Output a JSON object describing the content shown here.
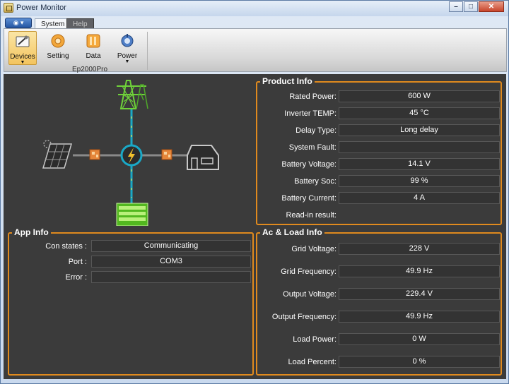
{
  "window": {
    "title": "Power Monitor",
    "controls": [
      "–",
      "□",
      "✕"
    ]
  },
  "ribbon": {
    "app_menu": "◉ ▾",
    "tabs": [
      {
        "label": "System",
        "active": true
      },
      {
        "label": "Help",
        "active": false
      }
    ],
    "buttons": [
      {
        "label": "Devices",
        "icon": "devices-icon",
        "selected": true
      },
      {
        "label": "Setting",
        "icon": "setting-icon"
      },
      {
        "label": "Data",
        "icon": "data-icon"
      },
      {
        "label": "Power",
        "icon": "power-icon"
      }
    ],
    "group_label": "Ep2000Pro"
  },
  "diagram": {
    "icons": [
      "grid-tower-icon",
      "solar-panel-icon",
      "converter-icon",
      "inverter-icon",
      "house-icon",
      "battery-icon"
    ]
  },
  "product_info": {
    "title": "Product Info",
    "rows": [
      {
        "label": "Rated Power:",
        "value": "600 W"
      },
      {
        "label": "Inverter TEMP:",
        "value": "45 °C"
      },
      {
        "label": "Delay Type:",
        "value": "Long delay"
      },
      {
        "label": "System Fault:",
        "value": ""
      },
      {
        "label": "Battery Voltage:",
        "value": "14.1 V"
      },
      {
        "label": "Battery Soc:",
        "value": "99 %"
      },
      {
        "label": "Battery Current:",
        "value": "4 A"
      },
      {
        "label": "Read-in result:",
        "value": ""
      }
    ]
  },
  "app_info": {
    "title": "App Info",
    "rows": [
      {
        "label": "Con states :",
        "value": "Communicating"
      },
      {
        "label": "Port :",
        "value": "COM3"
      },
      {
        "label": "Error :",
        "value": ""
      }
    ]
  },
  "ac_load_info": {
    "title": "Ac & Load Info",
    "rows": [
      {
        "label": "Grid Voltage:",
        "value": "228 V"
      },
      {
        "label": "Grid Frequency:",
        "value": "49.9 Hz"
      },
      {
        "label": "Output Voltage:",
        "value": "229.4 V"
      },
      {
        "label": "Output Frequency:",
        "value": "49.9 Hz"
      },
      {
        "label": "Load Power:",
        "value": "0 W"
      },
      {
        "label": "Load Percent:",
        "value": "0 %"
      }
    ]
  },
  "colors": {
    "panel_border": "#e08a1e",
    "background": "#3b3b3b",
    "flow_line": "#1aa8c6",
    "grid_green": "#6fd23a"
  }
}
